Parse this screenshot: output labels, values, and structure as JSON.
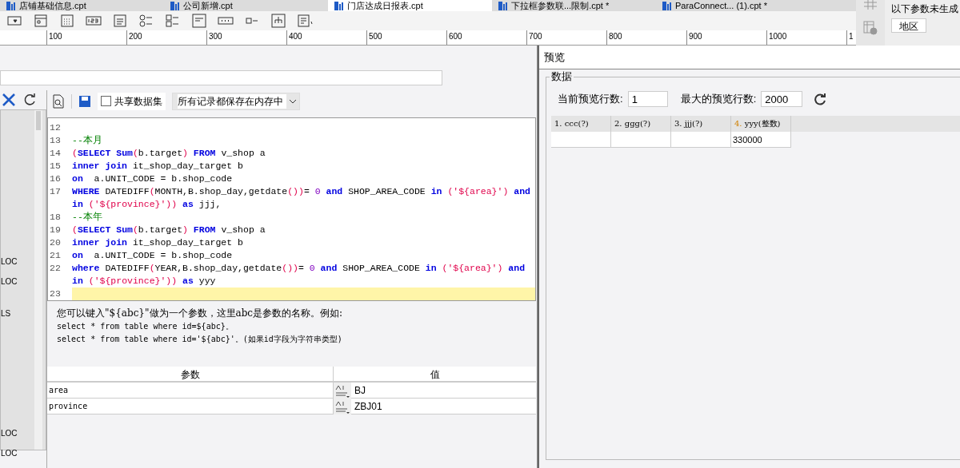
{
  "tabs": [
    {
      "label": "店铺基础信息.cpt",
      "selected": false
    },
    {
      "label": "公司新增.cpt",
      "selected": false
    },
    {
      "label": "门店达成日报表.cpt",
      "selected": true
    },
    {
      "label": "下拉框参数联...限制.cpt *",
      "selected": false
    },
    {
      "label": "ParaConnect... (1).cpt *",
      "selected": false
    }
  ],
  "ruler": {
    "ticks": [
      "100",
      "200",
      "300",
      "400",
      "500",
      "600",
      "700",
      "800",
      "900",
      "1000",
      "1"
    ]
  },
  "side_panel": {
    "notice": "以下参数未生成",
    "parameter_button": "地区"
  },
  "dataset_dialog": {
    "sidebar_items": [
      "LOC",
      "LOC",
      "LS",
      "LOC",
      "LOC"
    ],
    "share_dataset": {
      "label": "共享数据集",
      "checked": false
    },
    "storage_mode": "所有记录都保存在内存中",
    "code_lines": [
      {
        "number": "12",
        "current": false
      },
      {
        "number": "13",
        "current": false,
        "tokens": [
          {
            "kind": "comment",
            "text": "--本月"
          }
        ]
      },
      {
        "number": "14",
        "current": false,
        "tokens": [
          {
            "kind": "paren",
            "text": "("
          },
          {
            "kind": "keyword",
            "text": "SELECT"
          },
          {
            "kind": "keyword",
            "text": " Sum"
          },
          {
            "kind": "paren",
            "text": "("
          },
          {
            "kind": "plain",
            "text": "b.target"
          },
          {
            "kind": "paren",
            "text": ")"
          },
          {
            "kind": "keyword",
            "text": " FROM"
          },
          {
            "kind": "plain",
            "text": " v_shop a"
          }
        ]
      },
      {
        "number": "15",
        "current": false,
        "tokens": [
          {
            "kind": "keyword",
            "text": "inner join"
          },
          {
            "kind": "plain",
            "text": " it_shop_day_target b"
          }
        ]
      },
      {
        "number": "16",
        "current": false,
        "tokens": [
          {
            "kind": "keyword",
            "text": "on"
          },
          {
            "kind": "plain",
            "text": "  a.UNIT_CODE = b.shop_code"
          }
        ]
      },
      {
        "number": "17",
        "current": false,
        "tokens": [
          {
            "kind": "keyword",
            "text": "WHERE"
          },
          {
            "kind": "plain",
            "text": " DATEDIFF"
          },
          {
            "kind": "paren",
            "text": "("
          },
          {
            "kind": "plain",
            "text": "MONTH,B.shop_day,getdate"
          },
          {
            "kind": "paren",
            "text": "())"
          },
          {
            "kind": "plain",
            "text": "="
          },
          {
            "kind": "number",
            "text": " 0"
          },
          {
            "kind": "keyword",
            "text": " and"
          },
          {
            "kind": "plain",
            "text": " SHOP_AREA_CODE"
          },
          {
            "kind": "keyword",
            "text": " in"
          },
          {
            "kind": "paren",
            "text": " ("
          },
          {
            "kind": "string",
            "text": "'${area}'"
          },
          {
            "kind": "paren",
            "text": ")"
          },
          {
            "kind": "keyword",
            "text": " and"
          }
        ],
        "wrap": [
          {
            "kind": "keyword",
            "text": "in"
          },
          {
            "kind": "paren",
            "text": " ("
          },
          {
            "kind": "string",
            "text": "'${province}'"
          },
          {
            "kind": "paren",
            "text": "))"
          },
          {
            "kind": "keyword",
            "text": " as"
          },
          {
            "kind": "plain",
            "text": " jjj,"
          }
        ]
      },
      {
        "number": "18",
        "current": false,
        "tokens": [
          {
            "kind": "comment",
            "text": "--本年"
          }
        ]
      },
      {
        "number": "19",
        "current": false,
        "tokens": [
          {
            "kind": "paren",
            "text": "("
          },
          {
            "kind": "keyword",
            "text": "SELECT"
          },
          {
            "kind": "keyword",
            "text": " Sum"
          },
          {
            "kind": "paren",
            "text": "("
          },
          {
            "kind": "plain",
            "text": "b.target"
          },
          {
            "kind": "paren",
            "text": ")"
          },
          {
            "kind": "keyword",
            "text": " FROM"
          },
          {
            "kind": "plain",
            "text": " v_shop a"
          }
        ]
      },
      {
        "number": "20",
        "current": false,
        "tokens": [
          {
            "kind": "keyword",
            "text": "inner join"
          },
          {
            "kind": "plain",
            "text": " it_shop_day_target b"
          }
        ]
      },
      {
        "number": "21",
        "current": false,
        "tokens": [
          {
            "kind": "keyword",
            "text": "on"
          },
          {
            "kind": "plain",
            "text": "  a.UNIT_CODE = b.shop_code"
          }
        ]
      },
      {
        "number": "22",
        "current": false,
        "tokens": [
          {
            "kind": "keyword",
            "text": "where"
          },
          {
            "kind": "plain",
            "text": " DATEDIFF"
          },
          {
            "kind": "paren",
            "text": "("
          },
          {
            "kind": "plain",
            "text": "YEAR,B.shop_day,getdate"
          },
          {
            "kind": "paren",
            "text": "())"
          },
          {
            "kind": "plain",
            "text": "="
          },
          {
            "kind": "number",
            "text": " 0"
          },
          {
            "kind": "keyword",
            "text": " and"
          },
          {
            "kind": "plain",
            "text": " SHOP_AREA_CODE"
          },
          {
            "kind": "keyword",
            "text": " in"
          },
          {
            "kind": "paren",
            "text": " ("
          },
          {
            "kind": "string",
            "text": "'${area}'"
          },
          {
            "kind": "paren",
            "text": ")"
          },
          {
            "kind": "keyword",
            "text": " and"
          }
        ],
        "wrap": [
          {
            "kind": "keyword",
            "text": "in"
          },
          {
            "kind": "paren",
            "text": " ("
          },
          {
            "kind": "string",
            "text": "'${province}'"
          },
          {
            "kind": "paren",
            "text": "))"
          },
          {
            "kind": "keyword",
            "text": " as"
          },
          {
            "kind": "plain",
            "text": " yyy"
          }
        ]
      },
      {
        "number": "23",
        "current": true
      }
    ],
    "hint": [
      "您可以键入\"${abc}\"做为一个参数，这里abc是参数的名称。例如:",
      "select * from table where id=${abc}。",
      "select * from table where id='${abc}'。(如果id字段为字符串类型)"
    ],
    "parameters": {
      "columns": [
        "参数",
        "值"
      ],
      "rows": [
        {
          "name": "area",
          "value": "BJ"
        },
        {
          "name": "province",
          "value": "ZBJ01"
        }
      ]
    }
  },
  "preview": {
    "title": "预览",
    "group": "数据",
    "current_rows": {
      "label": "当前预览行数:",
      "value": "1"
    },
    "max_rows": {
      "label": "最大的预览行数:",
      "value": "2000"
    },
    "table": {
      "columns": [
        {
          "index": "1.",
          "name": "ccc(?)",
          "highlighted": false
        },
        {
          "index": "2.",
          "name": "ggg(?)",
          "highlighted": false
        },
        {
          "index": "3.",
          "name": "jjj(?)",
          "highlighted": false
        },
        {
          "index": "4.",
          "name": "yyy(整数)",
          "highlighted": true
        }
      ],
      "rows": [
        [
          null,
          null,
          null,
          "330000"
        ]
      ]
    }
  }
}
